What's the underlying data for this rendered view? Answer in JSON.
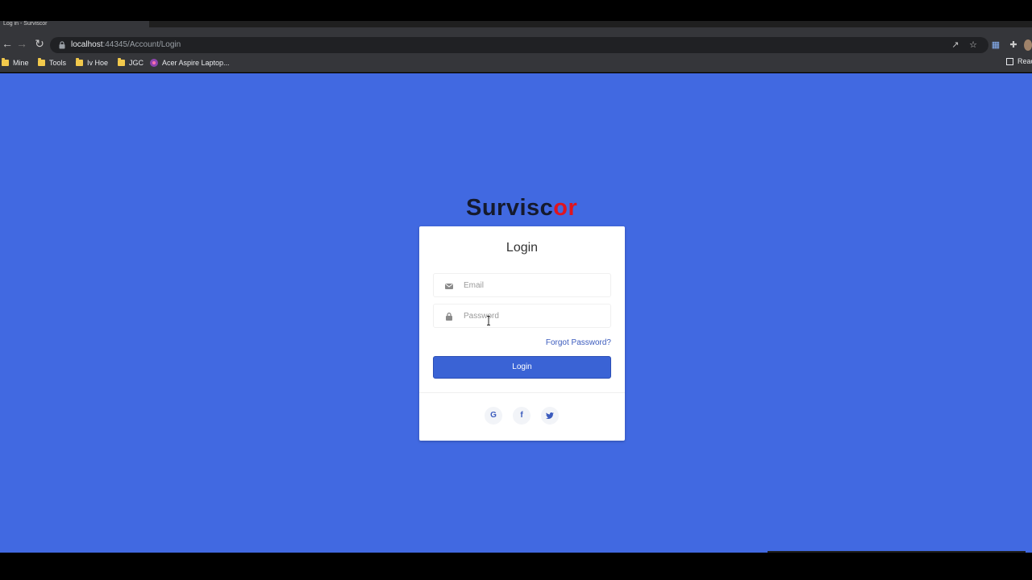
{
  "browser": {
    "tab_title": "Log in - Surviscor",
    "url_host": "localhost",
    "url_rest": ":44345/Account/Login",
    "bookmarks": [
      "Mine",
      "Tools",
      "Iv Hoe",
      "JGC",
      "Acer Aspire Laptop..."
    ],
    "reading_list_label": "Reac"
  },
  "logo": {
    "text_dark": "Survisc",
    "text_red": "o",
    "text_end": "r"
  },
  "login_card": {
    "title": "Login",
    "email_placeholder": "Email",
    "password_placeholder": "Password",
    "forgot_label": "Forgot Password?",
    "login_button": "Login",
    "social": [
      "G",
      "f",
      "t"
    ]
  },
  "colors": {
    "page_background": "#4169e1",
    "button": "#3a63d5",
    "brand_red": "#e0141e",
    "brand_dark": "#151a2d"
  }
}
